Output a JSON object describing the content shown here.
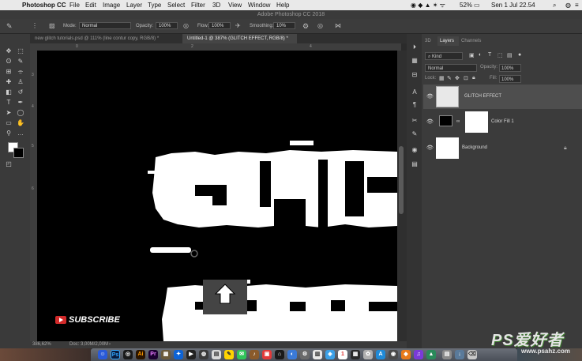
{
  "menubar": {
    "app_name": "Photoshop CC",
    "items": [
      "File",
      "Edit",
      "Image",
      "Layer",
      "Type",
      "Select",
      "Filter",
      "3D",
      "View",
      "Window",
      "Help"
    ],
    "battery": "52%",
    "datetime": "Sen 1 Jul  22.54"
  },
  "window_title": "Adobe Photoshop CC 2018",
  "options": {
    "mode_label": "Mode:",
    "mode_value": "Normal",
    "opacity_label": "Opacity:",
    "opacity_value": "100%",
    "flow_label": "Flow:",
    "flow_value": "100%",
    "smoothing_label": "Smoothing:",
    "smoothing_value": "10%"
  },
  "doc_tabs": [
    {
      "label": "new glitch tutorials.psd @ 111% (line contur copy, RGB/8) *"
    },
    {
      "label": "Untitled-1 @ 387% (GLITCH EFFECT, RGB/8) *"
    }
  ],
  "ruler": {
    "top_ticks": [
      "0",
      "2",
      "4"
    ],
    "left_ticks": [
      "3",
      "4",
      "5",
      "6"
    ]
  },
  "status": {
    "zoom": "386,62%",
    "doc": "Doc: 3,00M/2,00M"
  },
  "overlay": {
    "subscribe": "SUBSCRIBE"
  },
  "panel_tabs": [
    "3D",
    "Layers",
    "Channels"
  ],
  "layers_panel": {
    "kind_label": "Kind",
    "blend_value": "Normal",
    "opacity_label": "Opacity:",
    "opacity_value": "100%",
    "lock_label": "Lock:",
    "fill_label": "Fill:",
    "fill_value": "100%",
    "layers": [
      {
        "name": "GLITCH EFFECT"
      },
      {
        "name": "Color Fill 1"
      },
      {
        "name": "Background"
      }
    ]
  },
  "watermark": {
    "main": "PS爱好者",
    "url": "www.psahz.com"
  },
  "colors": {
    "canvas": "#000000",
    "accent_red": "#d22a2a",
    "panel": "#3b3b3b"
  }
}
